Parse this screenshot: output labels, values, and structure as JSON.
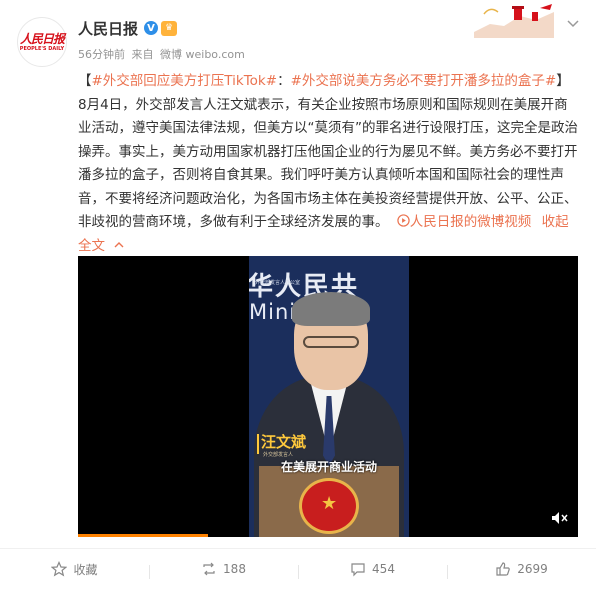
{
  "post": {
    "author": "人民日报",
    "avatar_logo_text": "人民日报",
    "avatar_logo_en": "PEOPLE'S DAILY",
    "time": "56分钟前",
    "source_prefix": "来自",
    "source": "微博 weibo.com",
    "content": {
      "bracket_open": "【",
      "tag1": "#外交部回应美方打压TikTok#",
      "sep": "：",
      "tag2": "#外交部说美方务必不要打开潘多拉的盒子#",
      "bracket_close": "】",
      "body": "8月4日，外交部发言人汪文斌表示，有关企业按照市场原则和国际规则在美展开商业活动，遵守美国法律法规，但美方以“莫须有”的罪名进行设限打压，这完全是政治操弄。事实上，美方动用国家机器打压他国企业的行为屡见不鲜。美方务必不要打开潘多拉的盒子，否则将自食其果。我们呼吁美方认真倾听本国和国际社会的理性声音，不要将经济问题政治化，为各国市场主体在美投资经营提供开放、公平、公正、非歧视的营商环境，多做有利于全球经济发展的事。",
      "video_link": "人民日报的微博视频",
      "collapse": "收起全文",
      "collapse_icon": "chevron-up-icon"
    }
  },
  "video": {
    "watermark": "外交部发言人办公室",
    "sign_cn": "华人民共",
    "sign_en": "Minist",
    "speaker_name": "汪文斌",
    "speaker_sub": "外交部发言人",
    "subtitle": "在美展开商业活动",
    "progress": 0.26
  },
  "actions": [
    {
      "name": "favorite",
      "icon": "star-icon",
      "label": "收藏"
    },
    {
      "name": "repost",
      "icon": "repost-icon",
      "label": "188"
    },
    {
      "name": "comment",
      "icon": "comment-icon",
      "label": "454"
    },
    {
      "name": "like",
      "icon": "thumb-up-icon",
      "label": "2699"
    }
  ],
  "colors": {
    "accent": "#eb7350",
    "verify": "#2e8fe8",
    "video_progress": "#ff8200"
  }
}
